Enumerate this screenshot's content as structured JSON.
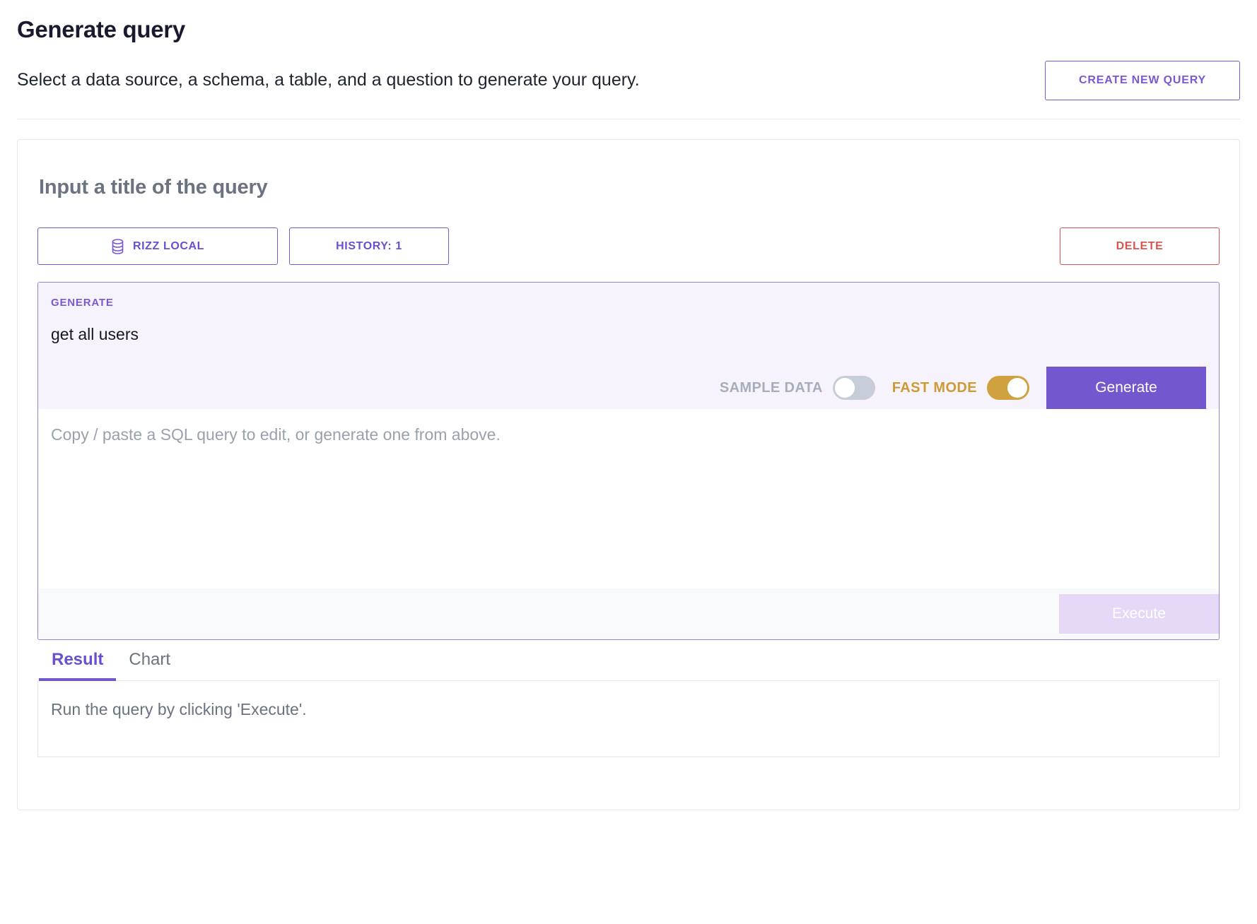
{
  "header": {
    "title": "Generate query",
    "subtitle": "Select a data source, a schema, a table, and a question to generate your query.",
    "create_button": "CREATE NEW QUERY"
  },
  "query": {
    "title_placeholder": "Input a title of the query",
    "title_value": "",
    "data_source_button": "RIZZ LOCAL",
    "data_source_icon": "database-icon",
    "history_button": "HISTORY: 1",
    "delete_button": "DELETE"
  },
  "generate_panel": {
    "label": "GENERATE",
    "prompt_value": "get all users",
    "prompt_placeholder": "get all users",
    "sample_data_label": "SAMPLE DATA",
    "sample_data_on": false,
    "fast_mode_label": "FAST MODE",
    "fast_mode_on": true,
    "generate_button": "Generate"
  },
  "editor": {
    "placeholder": "Copy / paste a SQL query to edit, or generate one from above.",
    "value": "",
    "execute_button": "Execute",
    "execute_disabled": true
  },
  "results": {
    "tabs": [
      {
        "label": "Result",
        "active": true
      },
      {
        "label": "Chart",
        "active": false
      }
    ],
    "empty_message": "Run the query by clicking 'Execute'."
  },
  "colors": {
    "accent_purple": "#7357ce",
    "accent_purple_light": "#9b7ede",
    "panel_bg": "#f6f3fd",
    "danger_red": "#d9534f",
    "gold": "#cfa23f",
    "muted_gray": "#6b7280"
  }
}
